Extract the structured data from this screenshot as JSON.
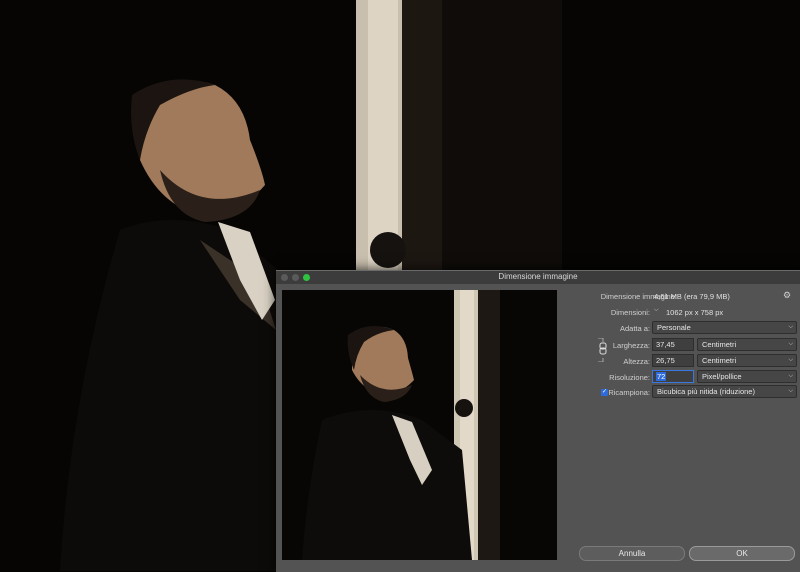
{
  "dialog": {
    "title": "Dimensione immagine",
    "image_size_label": "Dimensione immagine:",
    "image_size_value": "4,61 MB (era 79,9 MB)",
    "dimensions_label": "Dimensioni:",
    "dimensions_value": "1062 px x 758 px",
    "fit_to_label": "Adatta a:",
    "fit_to_value": "Personale",
    "width_label": "Larghezza:",
    "width_value": "37,45",
    "width_unit": "Centimetri",
    "height_label": "Altezza:",
    "height_value": "26,75",
    "height_unit": "Centimetri",
    "resolution_label": "Risoluzione:",
    "resolution_value": "72",
    "resolution_unit": "Pixel/pollice",
    "resample_label": "Ricampiona:",
    "resample_checked": true,
    "resample_value": "Bicubica più nitida (riduzione)",
    "cancel_label": "Annulla",
    "ok_label": "OK"
  },
  "icons": {
    "gear": "gear-icon",
    "chain": "chain-link-icon",
    "chevron": "chevron-updown-icon",
    "check": "checkmark-icon"
  },
  "colors": {
    "dialog_bg": "#535353",
    "titlebar_bg": "#3c3c3c",
    "selection": "#2f6bd8",
    "zoom_button": "#2fc341"
  }
}
